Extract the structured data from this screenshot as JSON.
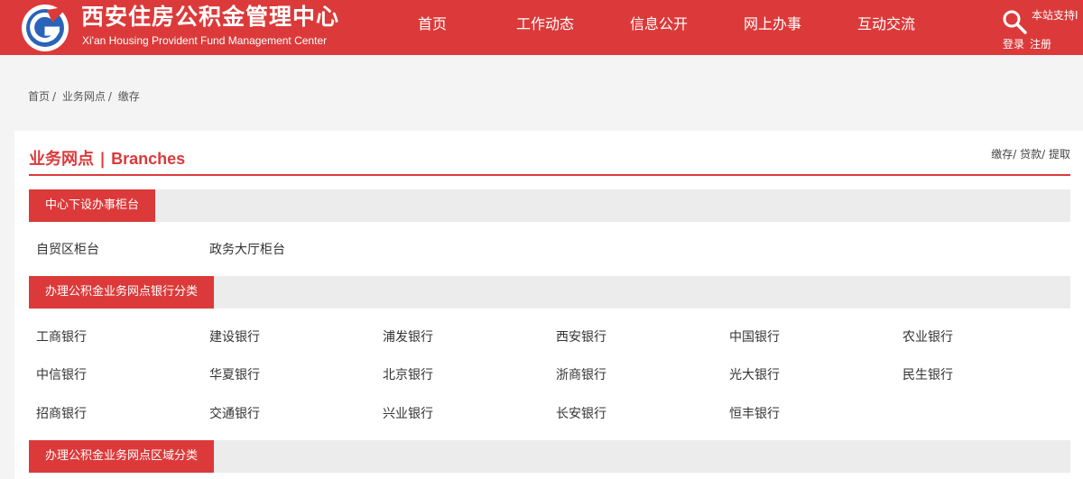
{
  "header": {
    "title_cn": "西安住房公积金管理中心",
    "title_en": "Xi'an Housing Provident Fund Management Center",
    "nav": [
      "首页",
      "工作动态",
      "信息公开",
      "网上办事",
      "互动交流"
    ],
    "search_label": "本站支持I",
    "login": "登录",
    "register": "注册",
    "brand_color": "#dc3a3a"
  },
  "breadcrumb": [
    "首页",
    "业务网点",
    "缴存"
  ],
  "panel": {
    "title_cn": "业务网点",
    "title_sep": " | ",
    "title_en": "Branches",
    "tabs": [
      "缴存",
      "贷款",
      "提取"
    ]
  },
  "sections": [
    {
      "label": "中心下设办事柜台",
      "items": [
        "自贸区柜台",
        "政务大厅柜台"
      ]
    },
    {
      "label": "办理公积金业务网点银行分类",
      "items": [
        "工商银行",
        "建设银行",
        "浦发银行",
        "西安银行",
        "中国银行",
        "农业银行",
        "中信银行",
        "华夏银行",
        "北京银行",
        "浙商银行",
        "光大银行",
        "民生银行",
        "招商银行",
        "交通银行",
        "兴业银行",
        "长安银行",
        "恒丰银行"
      ]
    },
    {
      "label": "办理公积金业务网点区域分类",
      "items": []
    }
  ]
}
